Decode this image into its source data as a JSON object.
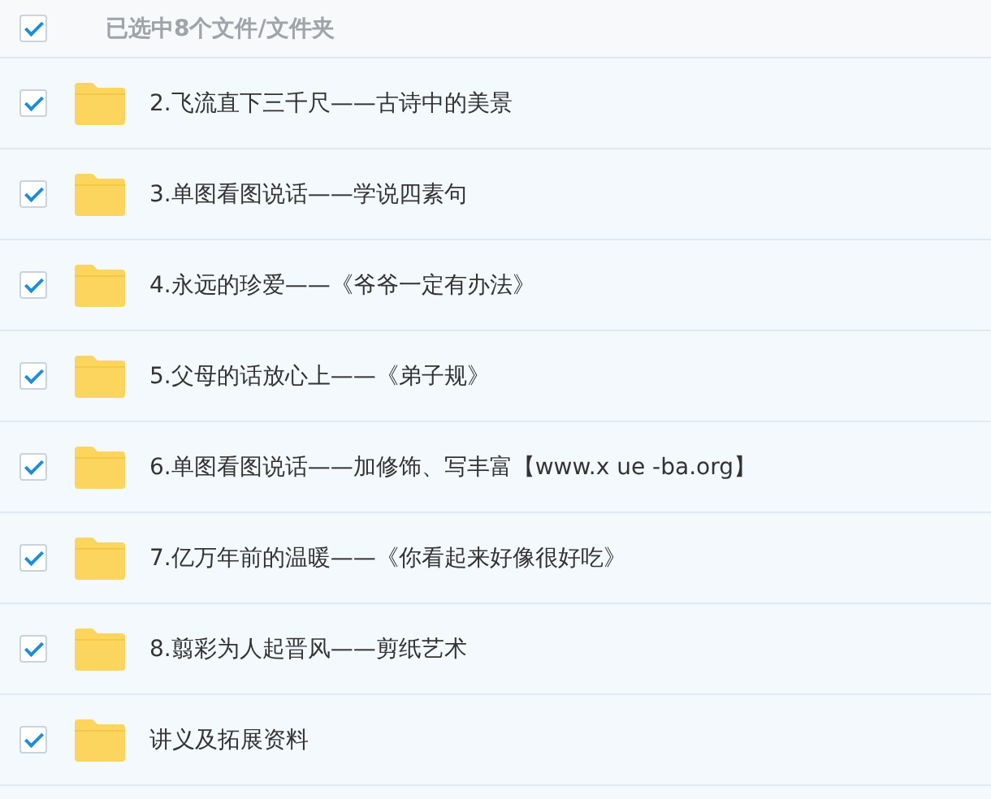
{
  "header": {
    "checked": true,
    "label": "已选中8个文件/文件夹"
  },
  "items": [
    {
      "name": "2.飞流直下三千尺——古诗中的美景",
      "checked": true
    },
    {
      "name": "3.单图看图说话——学说四素句",
      "checked": true
    },
    {
      "name": "4.永远的珍爱——《爷爷一定有办法》",
      "checked": true
    },
    {
      "name": "5.父母的话放心上——《弟子规》",
      "checked": true
    },
    {
      "name": "6.单图看图说话——加修饰、写丰富【www.x ue -ba.org】",
      "checked": true
    },
    {
      "name": "7.亿万年前的温暖——《你看起来好像很好吃》",
      "checked": true
    },
    {
      "name": "8.翦彩为人起晋风——剪纸艺术",
      "checked": true
    },
    {
      "name": "讲义及拓展资料",
      "checked": true
    }
  ]
}
